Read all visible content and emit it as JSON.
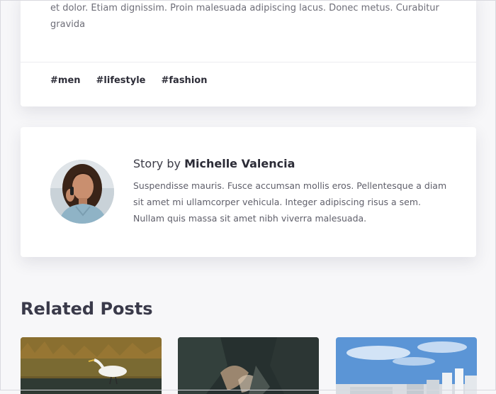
{
  "article": {
    "text": "et dolor. Etiam dignissim. Proin malesuada adipiscing lacus. Donec metus. Curabitur gravida",
    "tags": [
      "#men",
      "#lifestyle",
      "#fashion"
    ]
  },
  "author": {
    "prefix": "Story by",
    "name": "Michelle Valencia",
    "bio": "Suspendisse mauris. Fusce accumsan mollis eros. Pellentesque a diam sit amet mi ullamcorper vehicula. Integer adipiscing risus a sem. Nullam quis massa sit amet nibh viverra malesuada."
  },
  "related": {
    "title": "Related Posts"
  }
}
